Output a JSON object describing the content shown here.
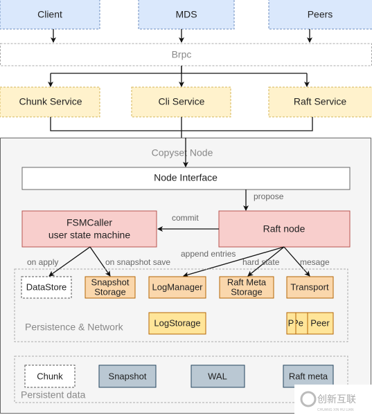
{
  "top": {
    "client": "Client",
    "mds": "MDS",
    "peers": "Peers"
  },
  "brpc": "Brpc",
  "services": {
    "chunk": "Chunk Service",
    "cli": "Cli Service",
    "raft": "Raft Service"
  },
  "copyset": {
    "title": "Copyset Node",
    "node_interface": "Node Interface",
    "propose": "propose",
    "commit": "commit",
    "fsm_line1": "FSMCaller",
    "fsm_line2": "user state machine",
    "raft_node": "Raft node",
    "edges": {
      "on_apply": "on apply",
      "on_snapshot_save": "on snapshot save",
      "append_entries": "append entries",
      "hard_state": "hard state",
      "mesage": "mesage"
    }
  },
  "persistence": {
    "title": "Persistence & Network",
    "datastore": "DataStore",
    "snapshot_storage_1": "Snapshot",
    "snapshot_storage_2": "Storage",
    "logmanager": "LogManager",
    "raft_meta_1": "Raft Meta",
    "raft_meta_2": "Storage",
    "transport": "Transport",
    "logstorage": "LogStorage",
    "peers": [
      "P",
      "Pe",
      "Peer"
    ]
  },
  "persistent_data": {
    "title": "Persistent data",
    "items": [
      "Chunk",
      "Snapshot",
      "WAL",
      "Raft meta"
    ]
  },
  "watermark": {
    "text": "创新互联",
    "sub": "CHUANG XIN HU LIAN"
  },
  "colors": {
    "blue_fill": "#dae8fc",
    "blue_border": "#6c8ebf",
    "yellow_fill": "#fff2cc",
    "yellow_border": "#d6b656",
    "red_fill": "#f8cecc",
    "red_border": "#b85450",
    "orange_fill": "#fad7ac",
    "orange_border": "#b46504",
    "grey_fill": "#bac8d3",
    "grey_border": "#23445d"
  }
}
